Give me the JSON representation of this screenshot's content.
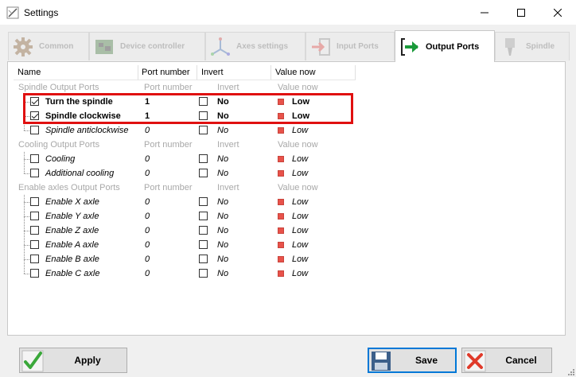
{
  "window": {
    "title": "Settings"
  },
  "tabs": [
    {
      "label": "Common",
      "icon": "gear-icon"
    },
    {
      "label": "Device controller",
      "icon": "circuit-board-icon"
    },
    {
      "label": "Axes settings",
      "icon": "axes-icon"
    },
    {
      "label": "Input Ports",
      "icon": "input-port-icon"
    },
    {
      "label": "Output Ports",
      "icon": "output-port-icon",
      "active": true
    },
    {
      "label": "Spindle",
      "icon": "spindle-icon"
    }
  ],
  "grid": {
    "headers": {
      "name": "Name",
      "port": "Port number",
      "invert": "Invert",
      "value": "Value now"
    },
    "groups": [
      {
        "name": "Spindle Output Ports",
        "port": "Port number",
        "invert": "Invert",
        "value": "Value now",
        "items": [
          {
            "name": "Turn the spindle",
            "checked": true,
            "port": "1",
            "invert": "No",
            "value": "Low"
          },
          {
            "name": "Spindle clockwise",
            "checked": true,
            "port": "1",
            "invert": "No",
            "value": "Low"
          },
          {
            "name": "Spindle anticlockwise",
            "checked": false,
            "port": "0",
            "invert": "No",
            "value": "Low"
          }
        ]
      },
      {
        "name": "Cooling Output Ports",
        "port": "Port number",
        "invert": "Invert",
        "value": "Value now",
        "items": [
          {
            "name": "Cooling",
            "checked": false,
            "port": "0",
            "invert": "No",
            "value": "Low"
          },
          {
            "name": "Additional cooling",
            "checked": false,
            "port": "0",
            "invert": "No",
            "value": "Low"
          }
        ]
      },
      {
        "name": "Enable axles Output Ports",
        "port": "Port number",
        "invert": "Invert",
        "value": "Value now",
        "items": [
          {
            "name": "Enable X axle",
            "checked": false,
            "port": "0",
            "invert": "No",
            "value": "Low"
          },
          {
            "name": "Enable Y axle",
            "checked": false,
            "port": "0",
            "invert": "No",
            "value": "Low"
          },
          {
            "name": "Enable Z axle",
            "checked": false,
            "port": "0",
            "invert": "No",
            "value": "Low"
          },
          {
            "name": "Enable A axle",
            "checked": false,
            "port": "0",
            "invert": "No",
            "value": "Low"
          },
          {
            "name": "Enable B axle",
            "checked": false,
            "port": "0",
            "invert": "No",
            "value": "Low"
          },
          {
            "name": "Enable C axle",
            "checked": false,
            "port": "0",
            "invert": "No",
            "value": "Low"
          }
        ]
      }
    ]
  },
  "buttons": {
    "apply": "Apply",
    "save": "Save",
    "cancel": "Cancel"
  },
  "colors": {
    "highlight": "#e01010",
    "led_low": "#e8524a",
    "output_arrow": "#1a9a3a",
    "input_arrow": "#e0302a"
  }
}
